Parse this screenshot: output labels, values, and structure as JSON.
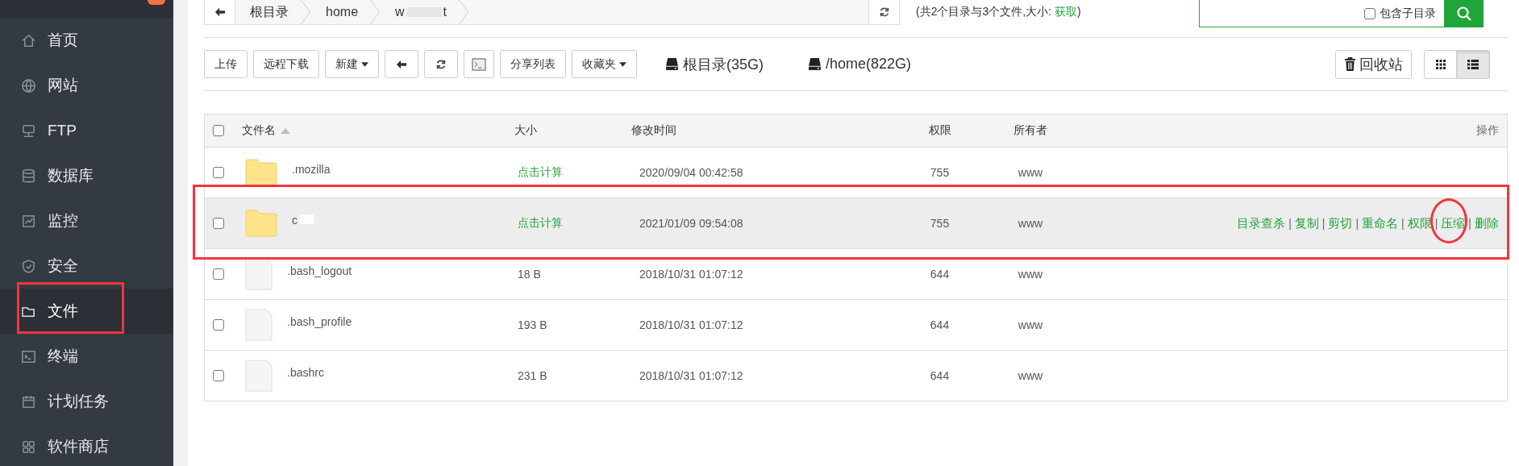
{
  "sidebar": {
    "items": [
      {
        "label": "首页",
        "selected": false
      },
      {
        "label": "网站",
        "selected": false
      },
      {
        "label": "FTP",
        "selected": false
      },
      {
        "label": "数据库",
        "selected": false
      },
      {
        "label": "监控",
        "selected": false
      },
      {
        "label": "安全",
        "selected": false
      },
      {
        "label": "文件",
        "selected": true
      },
      {
        "label": "终端",
        "selected": false
      },
      {
        "label": "计划任务",
        "selected": false
      },
      {
        "label": "软件商店",
        "selected": false
      }
    ]
  },
  "breadcrumb": [
    {
      "label": "根目录"
    },
    {
      "label": "home"
    },
    {
      "label_start": "w",
      "label_end": "t"
    }
  ],
  "summary": {
    "text": "(共2个目录与3个文件,大小: ",
    "link": "获取",
    "close": ")"
  },
  "search": {
    "subdir_label": "包含子目录",
    "subdir_checked": false
  },
  "toolbar": [
    {
      "kind": "text",
      "label": "上传"
    },
    {
      "kind": "text",
      "label": "远程下载"
    },
    {
      "kind": "dropdown",
      "label": "新建"
    },
    {
      "kind": "back"
    },
    {
      "kind": "refresh"
    },
    {
      "kind": "terminal"
    },
    {
      "kind": "text",
      "label": "分享列表"
    },
    {
      "kind": "dropdown",
      "label": "收藏夹"
    }
  ],
  "disks": [
    {
      "label": "根目录(35G)"
    },
    {
      "label": "/home(822G)"
    }
  ],
  "recycle_label": "回收站",
  "views": [
    {
      "kind": "grid",
      "selected": false
    },
    {
      "kind": "list",
      "selected": true
    }
  ],
  "table": {
    "select_all_checked": false,
    "action_separator": "|",
    "columns": [
      "文件名",
      "大小",
      "修改时间",
      "权限",
      "所有者",
      "操作"
    ],
    "rows": [
      {
        "kind": "folder",
        "name": ".mozilla",
        "redacted": false,
        "size": "点击计算",
        "size_link": true,
        "mtime": "2020/09/04 00:42:58",
        "perm": "755",
        "owner": "www",
        "selected": false,
        "checked": false,
        "actions": []
      },
      {
        "kind": "folder",
        "name": "c",
        "redacted": true,
        "size": "点击计算",
        "size_link": true,
        "mtime": "2021/01/09 09:54:08",
        "perm": "755",
        "owner": "www",
        "selected": true,
        "checked": false,
        "actions": [
          "目录查杀",
          "复制",
          "剪切",
          "重命名",
          "权限",
          "压缩",
          "删除"
        ]
      },
      {
        "kind": "file",
        "name": ".bash_logout",
        "redacted": false,
        "size": "18 B",
        "size_link": false,
        "mtime": "2018/10/31 01:07:12",
        "perm": "644",
        "owner": "www",
        "selected": false,
        "checked": false,
        "actions": []
      },
      {
        "kind": "file",
        "name": ".bash_profile",
        "redacted": false,
        "size": "193 B",
        "size_link": false,
        "mtime": "2018/10/31 01:07:12",
        "perm": "644",
        "owner": "www",
        "selected": false,
        "checked": false,
        "actions": []
      },
      {
        "kind": "file",
        "name": ".bashrc",
        "redacted": false,
        "size": "231 B",
        "size_link": false,
        "mtime": "2018/10/31 01:07:12",
        "perm": "644",
        "owner": "www",
        "selected": false,
        "checked": false,
        "actions": []
      }
    ]
  }
}
